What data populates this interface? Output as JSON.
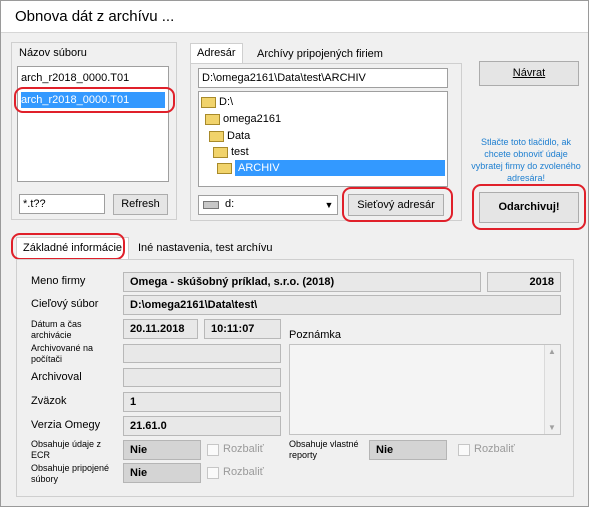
{
  "window": {
    "title": "Obnova dát z archívu ..."
  },
  "files": {
    "header": "Názov súboru",
    "items": [
      "arch_r2018_0000.T01",
      "arch_r2018_0000.T01"
    ],
    "filter_value": "*.t??",
    "refresh_label": "Refresh"
  },
  "tabs_top": {
    "tab1": "Adresár",
    "tab2": "Archívy pripojených firiem"
  },
  "directory": {
    "path": "D:\\omega2161\\Data\\test\\ARCHIV",
    "tree": [
      "D:\\",
      "omega2161",
      "Data",
      "test",
      "ARCHIV"
    ],
    "drive": "d:",
    "network_label": "Sieťový adresár"
  },
  "actions": {
    "back_label": "Návrat",
    "hint": "Stlačte toto tlačidlo, ak chcete obnoviť údaje vybratej firmy do zvoleného adresára!",
    "restore_label": "Odarchivuj!"
  },
  "tabs_bottom": {
    "tab1": "Základné informácie",
    "tab2": "Iné nastavenia, test archívu"
  },
  "info": {
    "company_label": "Meno firmy",
    "company_value": "Omega - skúšobný príklad, s.r.o. (2018)",
    "year_value": "2018",
    "target_label": "Cieľový súbor",
    "target_value": "D:\\omega2161\\Data\\test\\",
    "datetime_label": "Dátum a čas archivácie",
    "date_value": "20.11.2018",
    "time_value": "10:11:07",
    "archived_on_label": "Archivované na počítači",
    "archived_by_label": "Archivoval",
    "volume_label": "Zväzok",
    "volume_value": "1",
    "version_label": "Verzia Omegy",
    "version_value": "21.61.0",
    "ecr_label": "Obsahuje údaje z ECR",
    "ecr_value": "Nie",
    "attached_label": "Obsahuje pripojené súbory",
    "attached_value": "Nie",
    "note_label": "Poznámka",
    "own_reports_label": "Obsahuje vlastné reporty",
    "own_reports_value": "Nie",
    "expand_label": "Rozbaliť"
  },
  "colors": {
    "selection": "#3399ff",
    "highlight": "#e0202a",
    "hint_text": "#1e7fd0"
  }
}
